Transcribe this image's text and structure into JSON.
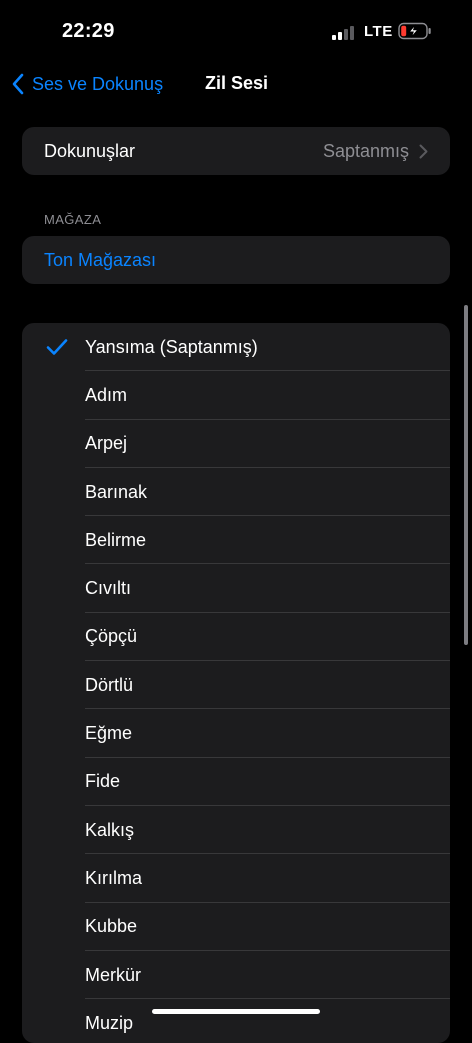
{
  "status_bar": {
    "time": "22:29",
    "network": "LTE",
    "battery_color": "#ff3b30"
  },
  "nav": {
    "back_label": "Ses ve Dokunuş",
    "title": "Zil Sesi"
  },
  "haptics": {
    "label": "Dokunuşlar",
    "value": "Saptanmış"
  },
  "store_section": {
    "header": "MAĞAZA",
    "link": "Ton Mağazası"
  },
  "tones": {
    "selected": "Yansıma (Saptanmış)",
    "items": [
      "Yansıma (Saptanmış)",
      "Adım",
      "Arpej",
      "Barınak",
      "Belirme",
      "Cıvıltı",
      "Çöpçü",
      "Dörtlü",
      "Eğme",
      "Fide",
      "Kalkış",
      "Kırılma",
      "Kubbe",
      "Merkür",
      "Muzip"
    ]
  },
  "colors": {
    "accent": "#0a84ff",
    "background": "#000000",
    "group_background": "#1c1c1e",
    "secondary_text": "#8e8e93"
  },
  "icons": {
    "back": "chevron-left-icon",
    "disclosure": "chevron-right-icon",
    "selected": "checkmark-icon",
    "signal": "cellular-signal-icon",
    "battery": "battery-charging-icon"
  }
}
